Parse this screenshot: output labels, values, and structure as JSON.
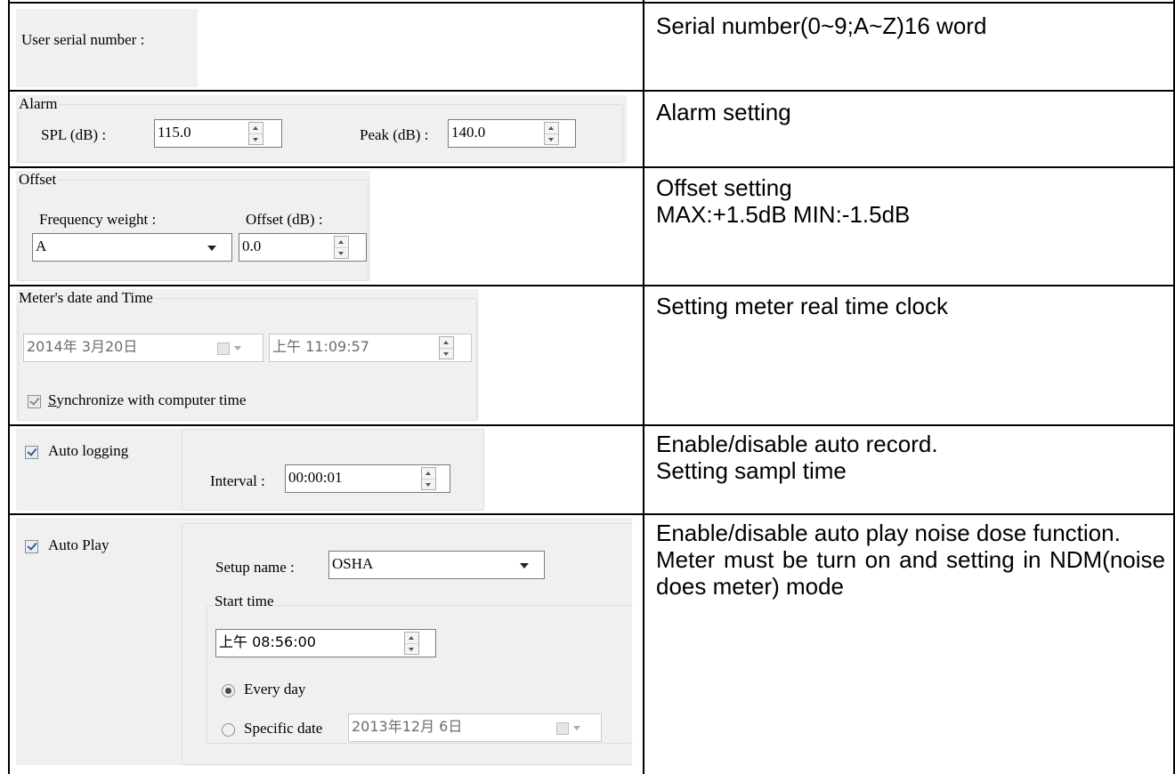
{
  "rows": [
    {
      "label": "User serial number :",
      "desc": [
        "Serial number(0~9;A~Z)16 word"
      ]
    },
    {
      "group": "Alarm",
      "spl_label": "SPL (dB) :",
      "spl_value": "115.0",
      "peak_label": "Peak (dB) :",
      "peak_value": "140.0",
      "desc": [
        "Alarm setting"
      ]
    },
    {
      "group": "Offset",
      "freq_label": "Frequency weight :",
      "freq_value": "A",
      "offset_label": "Offset (dB) :",
      "offset_value": "0.0",
      "desc": [
        "Offset setting",
        "MAX:+1.5dB MIN:-1.5dB"
      ]
    },
    {
      "group": "Meter's date and Time",
      "date_value": "2014年  3月20日",
      "time_value": "上午 11:09:57",
      "sync_first": "S",
      "sync_rest": "ynchronize with computer time",
      "sync_checked": true,
      "desc": [
        "Setting meter real time clock"
      ]
    },
    {
      "check_label": "Auto logging",
      "checked": true,
      "interval_label": "Interval :",
      "interval_value": "00:00:01",
      "desc": [
        "Enable/disable auto record.",
        "Setting sampl time"
      ]
    },
    {
      "check_label": "Auto Play",
      "checked": true,
      "setup_label": "Setup name :",
      "setup_value": "OSHA",
      "start_group": "Start time",
      "start_value": "上午 08:56:00",
      "every_day": "Every day",
      "specific_date": "Specific date",
      "specific_value": "2013年12月  6日",
      "selected": "Every day",
      "desc": [
        "Enable/disable auto play noise dose function.",
        "Meter must be turn on and setting in NDM(noise does meter) mode"
      ]
    }
  ]
}
